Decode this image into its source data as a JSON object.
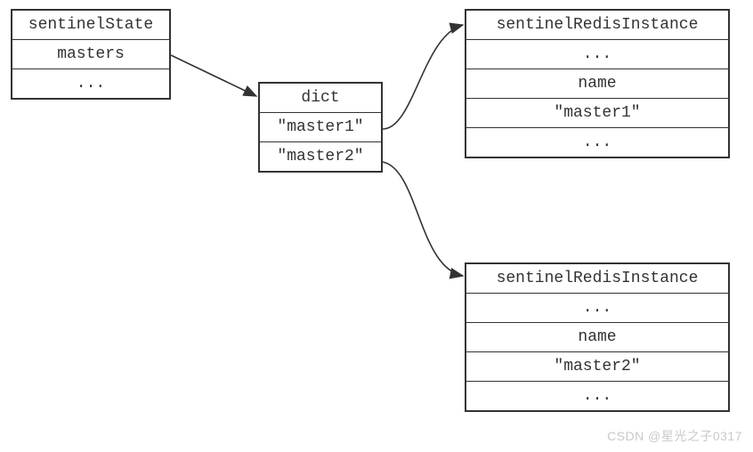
{
  "sentinelState": {
    "title": "sentinelState",
    "row1": "masters",
    "row2": "..."
  },
  "dict": {
    "title": "dict",
    "key1": "\"master1\"",
    "key2": "\"master2\""
  },
  "instance1": {
    "title": "sentinelRedisInstance",
    "r1": "...",
    "r2": "name",
    "r3": "\"master1\"",
    "r4": "..."
  },
  "instance2": {
    "title": "sentinelRedisInstance",
    "r1": "...",
    "r2": "name",
    "r3": "\"master2\"",
    "r4": "..."
  },
  "watermark": "CSDN @星光之子0317"
}
